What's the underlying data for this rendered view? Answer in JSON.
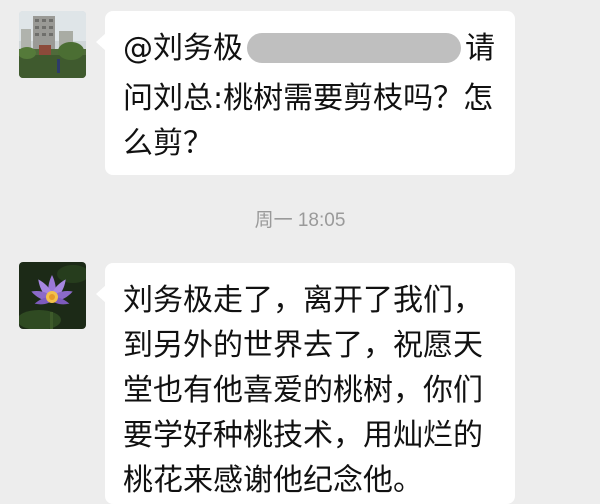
{
  "messages": [
    {
      "mention": "@刘务极",
      "after_redaction": "请",
      "lines": [
        "问刘总:桃树需要剪枝吗？怎",
        "么剪？"
      ]
    },
    {
      "lines": [
        "刘务极走了，离开了我们，",
        "到另外的世界去了，祝愿天",
        "堂也有他喜爱的桃树，你们",
        "要学好种桃技术，用灿烂的",
        "桃花来感谢他纪念他。"
      ]
    }
  ],
  "timestamp": "周一 18:05",
  "colors": {
    "background": "#ededed",
    "bubble": "#ffffff",
    "redaction": "#bfbfbf",
    "timestamp": "#9a9a9a"
  },
  "icons": {
    "avatar_1": "building-photo-avatar",
    "avatar_2": "purple-lotus-avatar"
  }
}
